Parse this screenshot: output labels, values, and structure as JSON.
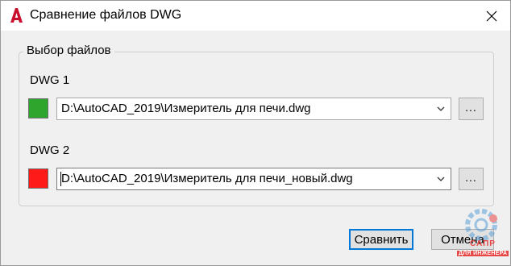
{
  "window": {
    "title": "Сравнение файлов DWG",
    "close_glyph": "×"
  },
  "group": {
    "legend": "Выбор файлов"
  },
  "dwg1": {
    "label": "DWG 1",
    "color": "#2ea62e",
    "path": "D:\\AutoCAD_2019\\Измеритель для печи.dwg",
    "browse_label": "..."
  },
  "dwg2": {
    "label": "DWG 2",
    "color": "#ff1a1a",
    "path": "D:\\AutoCAD_2019\\Измеритель для печи_новый.dwg",
    "browse_label": "..."
  },
  "buttons": {
    "compare": "Сравнить",
    "cancel": "Отмена"
  },
  "watermark": {
    "line1": "САПР",
    "line2": "ДЛЯ ИНЖЕНЕРА"
  }
}
